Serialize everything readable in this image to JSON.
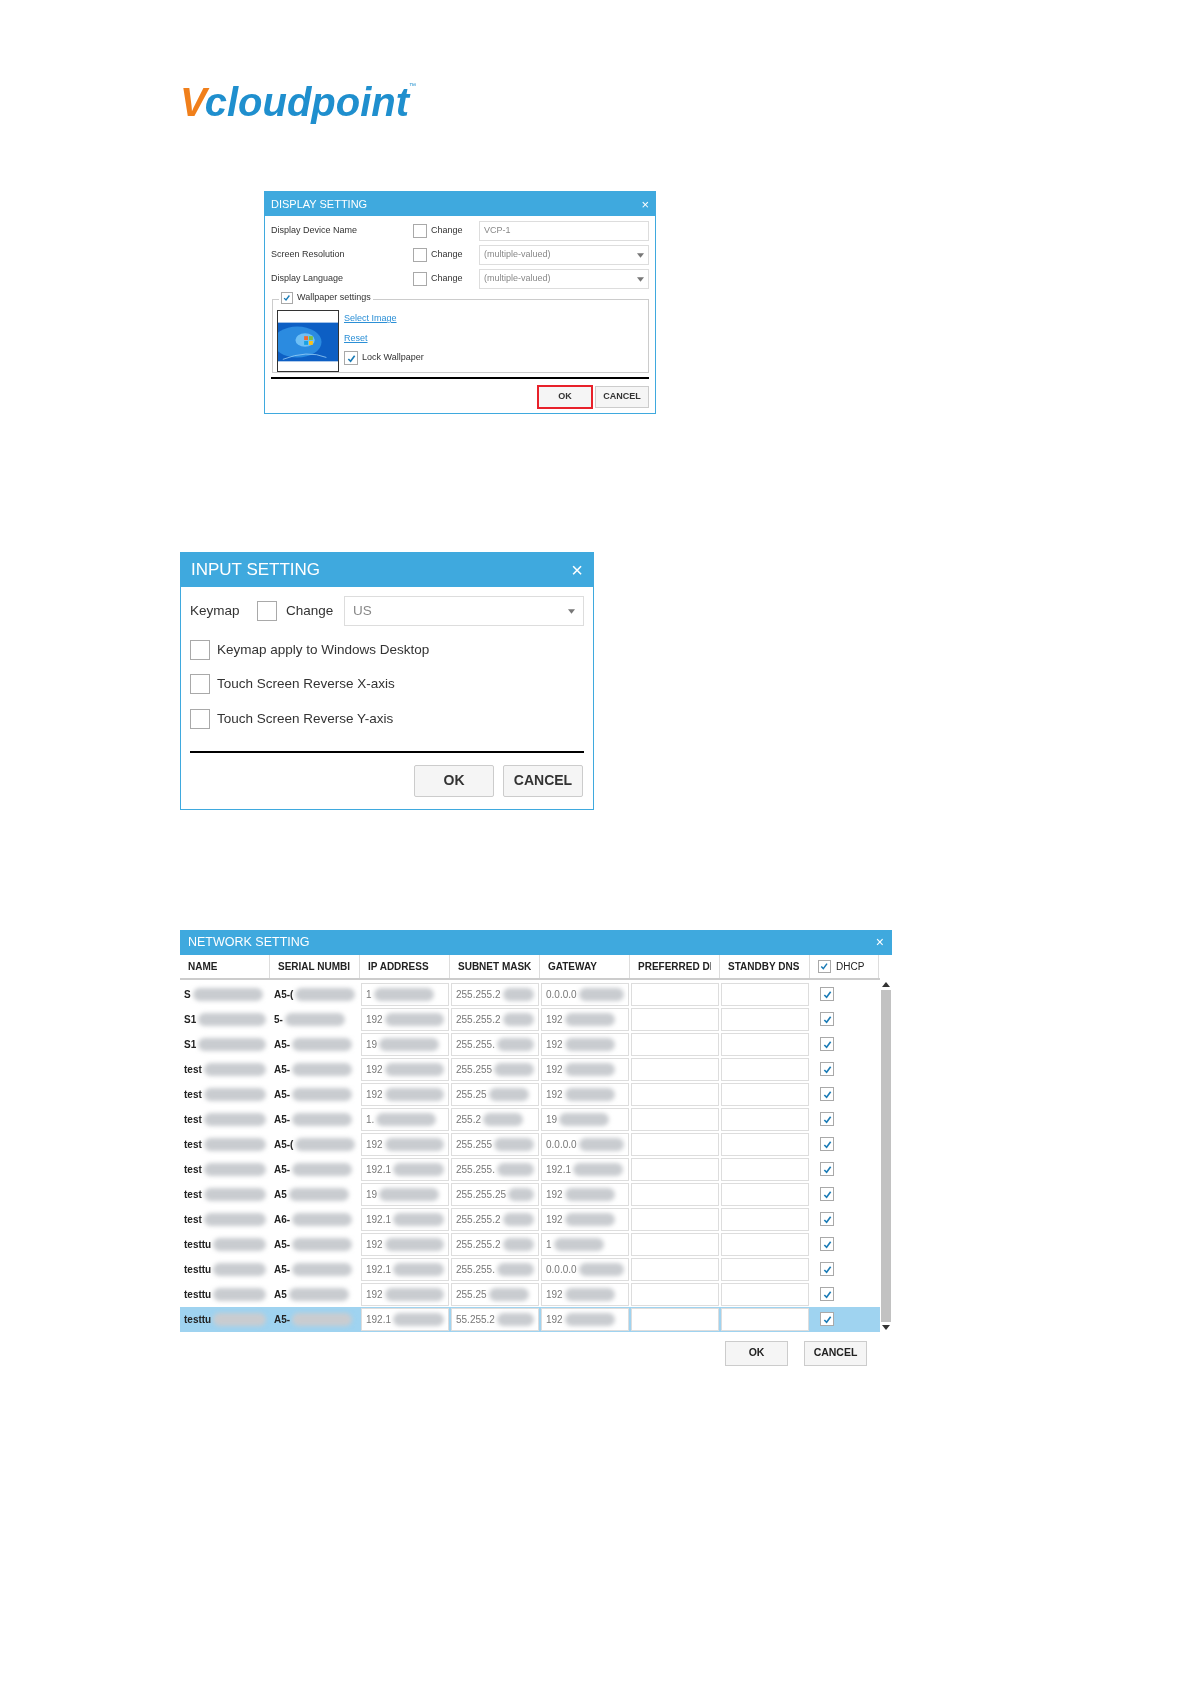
{
  "logo": {
    "mark": "V",
    "name": "cloudpoint",
    "tm": "™"
  },
  "display_setting": {
    "title": "DISPLAY SETTING",
    "close": "×",
    "rows": [
      {
        "label": "Display Device Name",
        "change": "Change",
        "checked": false,
        "kind": "text",
        "value": "VCP-1"
      },
      {
        "label": "Screen Resolution",
        "change": "Change",
        "checked": false,
        "kind": "dropdown",
        "value": "(multiple-valued)"
      },
      {
        "label": "Display Language",
        "change": "Change",
        "checked": false,
        "kind": "dropdown",
        "value": "(multiple-valued)"
      }
    ],
    "wallpaper": {
      "label": "Wallpaper settings",
      "checked": true,
      "select_link": "Select Image",
      "reset_link": "Reset",
      "lock_label": "Lock Wallpaper",
      "lock_checked": true
    },
    "buttons": [
      {
        "label": "OK",
        "highlighted": true
      },
      {
        "label": "CANCEL",
        "highlighted": false
      }
    ]
  },
  "input_setting": {
    "title": "INPUT SETTING",
    "close": "×",
    "keymap": {
      "label": "Keymap",
      "change": "Change",
      "checked": false,
      "value": "US"
    },
    "options": [
      {
        "label": "Keymap apply to Windows Desktop",
        "checked": false
      },
      {
        "label": "Touch Screen Reverse X-axis",
        "checked": false
      },
      {
        "label": "Touch Screen Reverse Y-axis",
        "checked": false
      }
    ],
    "buttons": [
      "OK",
      "CANCEL"
    ]
  },
  "network_setting": {
    "title": "NETWORK SETTING",
    "close": "×",
    "columns": [
      "NAME",
      "SERIAL NUMBI",
      "IP ADDRESS",
      "SUBNET MASK",
      "GATEWAY",
      "PREFERRED DI",
      "STANDBY DNS",
      "DHCP"
    ],
    "dhcp_all_checked": true,
    "rows": [
      {
        "name": "S",
        "serial": "A5-(",
        "ip": "1",
        "mask": "255.255.2",
        "gateway": "0.0.0.0",
        "dhcp": true,
        "selected": false
      },
      {
        "name": "S1",
        "serial": "5-",
        "ip": "192",
        "mask": "255.255.2",
        "gateway": "192",
        "dhcp": true,
        "selected": false
      },
      {
        "name": "S1",
        "serial": "A5-",
        "ip": "19",
        "mask": "255.255.",
        "gateway": "192",
        "dhcp": true,
        "selected": false
      },
      {
        "name": "test",
        "serial": "A5-",
        "ip": "192",
        "mask": "255.255",
        "gateway": "192",
        "dhcp": true,
        "selected": false
      },
      {
        "name": "test",
        "serial": "A5-",
        "ip": "192",
        "mask": "255.25",
        "gateway": "192",
        "dhcp": true,
        "selected": false
      },
      {
        "name": "test",
        "serial": "A5-",
        "ip": "1.",
        "mask": "255.2",
        "gateway": "19",
        "dhcp": true,
        "selected": false
      },
      {
        "name": "test",
        "serial": "A5-(",
        "ip": "192",
        "mask": "255.255",
        "gateway": "0.0.0.0",
        "dhcp": true,
        "selected": false
      },
      {
        "name": "test",
        "serial": "A5-",
        "ip": "192.1",
        "mask": "255.255.",
        "gateway": "192.1",
        "dhcp": true,
        "selected": false
      },
      {
        "name": "test",
        "serial": "A5",
        "ip": "19",
        "mask": "255.255.25",
        "gateway": "192",
        "dhcp": true,
        "selected": false
      },
      {
        "name": "test",
        "serial": "A6-",
        "ip": "192.1",
        "mask": "255.255.2",
        "gateway": "192",
        "dhcp": true,
        "selected": false
      },
      {
        "name": "testtu",
        "serial": "A5-",
        "ip": "192",
        "mask": "255.255.2",
        "gateway": "1",
        "dhcp": true,
        "selected": false
      },
      {
        "name": "testtu",
        "serial": "A5-",
        "ip": "192.1",
        "mask": "255.255.",
        "gateway": "0.0.0.0",
        "dhcp": true,
        "selected": false
      },
      {
        "name": "testtu",
        "serial": "A5",
        "ip": "192",
        "mask": "255.25",
        "gateway": "192",
        "dhcp": true,
        "selected": false
      },
      {
        "name": "testtu",
        "serial": "A5-",
        "ip": "192.1",
        "mask": "55.255.2",
        "gateway": "192",
        "dhcp": true,
        "selected": true
      }
    ],
    "buttons": [
      "OK",
      "CANCEL"
    ]
  }
}
